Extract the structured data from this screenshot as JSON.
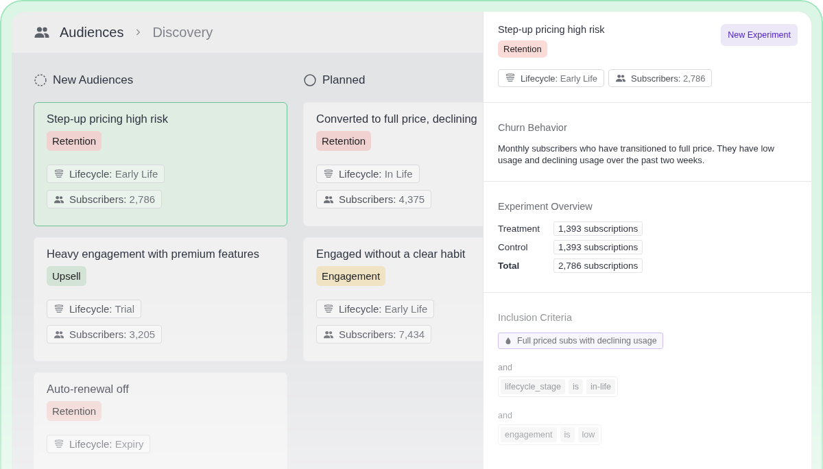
{
  "breadcrumb": [
    {
      "label": "Audiences"
    },
    {
      "label": "Discovery"
    }
  ],
  "columns": [
    {
      "title": "New Audiences",
      "kind": "new",
      "cards": [
        {
          "title": "Step-up pricing high risk",
          "selected": true,
          "tag": {
            "label": "Retention",
            "color": "#f0d3d0"
          },
          "lifecycle_label": "Lifecycle:",
          "lifecycle": "Early Life",
          "subscribers_label": "Subscribers:",
          "subscribers": "2,786"
        },
        {
          "title": "Heavy engagement with premium features",
          "selected": false,
          "tag": {
            "label": "Upsell",
            "color": "#d3e4d6"
          },
          "lifecycle_label": "Lifecycle:",
          "lifecycle": "Trial",
          "subscribers_label": "Subscribers:",
          "subscribers": "3,205"
        },
        {
          "title": "Auto-renewal off",
          "selected": false,
          "tag": {
            "label": "Retention",
            "color": "#f0d3d0"
          },
          "lifecycle_label": "Lifecycle:",
          "lifecycle": "Expiry"
        }
      ]
    },
    {
      "title": "Planned",
      "kind": "planned",
      "cards": [
        {
          "title": "Converted to full price, declining",
          "selected": false,
          "tag": {
            "label": "Retention",
            "color": "#f0d3d0"
          },
          "lifecycle_label": "Lifecycle:",
          "lifecycle": "In Life",
          "subscribers_label": "Subscribers:",
          "subscribers": "4,375"
        },
        {
          "title": "Engaged without a clear habit",
          "selected": false,
          "tag": {
            "label": "Engagement",
            "color": "#efe3c4"
          },
          "lifecycle_label": "Lifecycle:",
          "lifecycle": "Early Life",
          "subscribers_label": "Subscribers:",
          "subscribers": "7,434"
        }
      ]
    }
  ],
  "panel": {
    "title": "Step-up pricing high risk",
    "tag": {
      "label": "Retention",
      "color": "#fadbd8"
    },
    "button": "New Experiment",
    "lifecycle_label": "Lifecycle:",
    "lifecycle": "Early Life",
    "subscribers_label": "Subscribers:",
    "subscribers": "2,786",
    "churn": {
      "heading": "Churn Behavior",
      "text": "Monthly subscribers who have transitioned to full price. They have low usage and declining usage over the past two weeks."
    },
    "overview": {
      "heading": "Experiment Overview",
      "rows": [
        {
          "label": "Treatment",
          "value": "1,393 subscriptions",
          "total": false
        },
        {
          "label": "Control",
          "value": "1,393 subscriptions",
          "total": false
        },
        {
          "label": "Total",
          "value": "2,786 subscriptions",
          "total": true
        }
      ]
    },
    "criteria": {
      "heading": "Inclusion Criteria",
      "segment": "Full priced subs with declining usage",
      "conditions": [
        {
          "joiner": "and",
          "field": "lifecycle_stage",
          "operator": "is",
          "value": "in-life"
        },
        {
          "joiner": "and",
          "field": "engagement",
          "operator": "is",
          "value": "low"
        }
      ]
    }
  }
}
